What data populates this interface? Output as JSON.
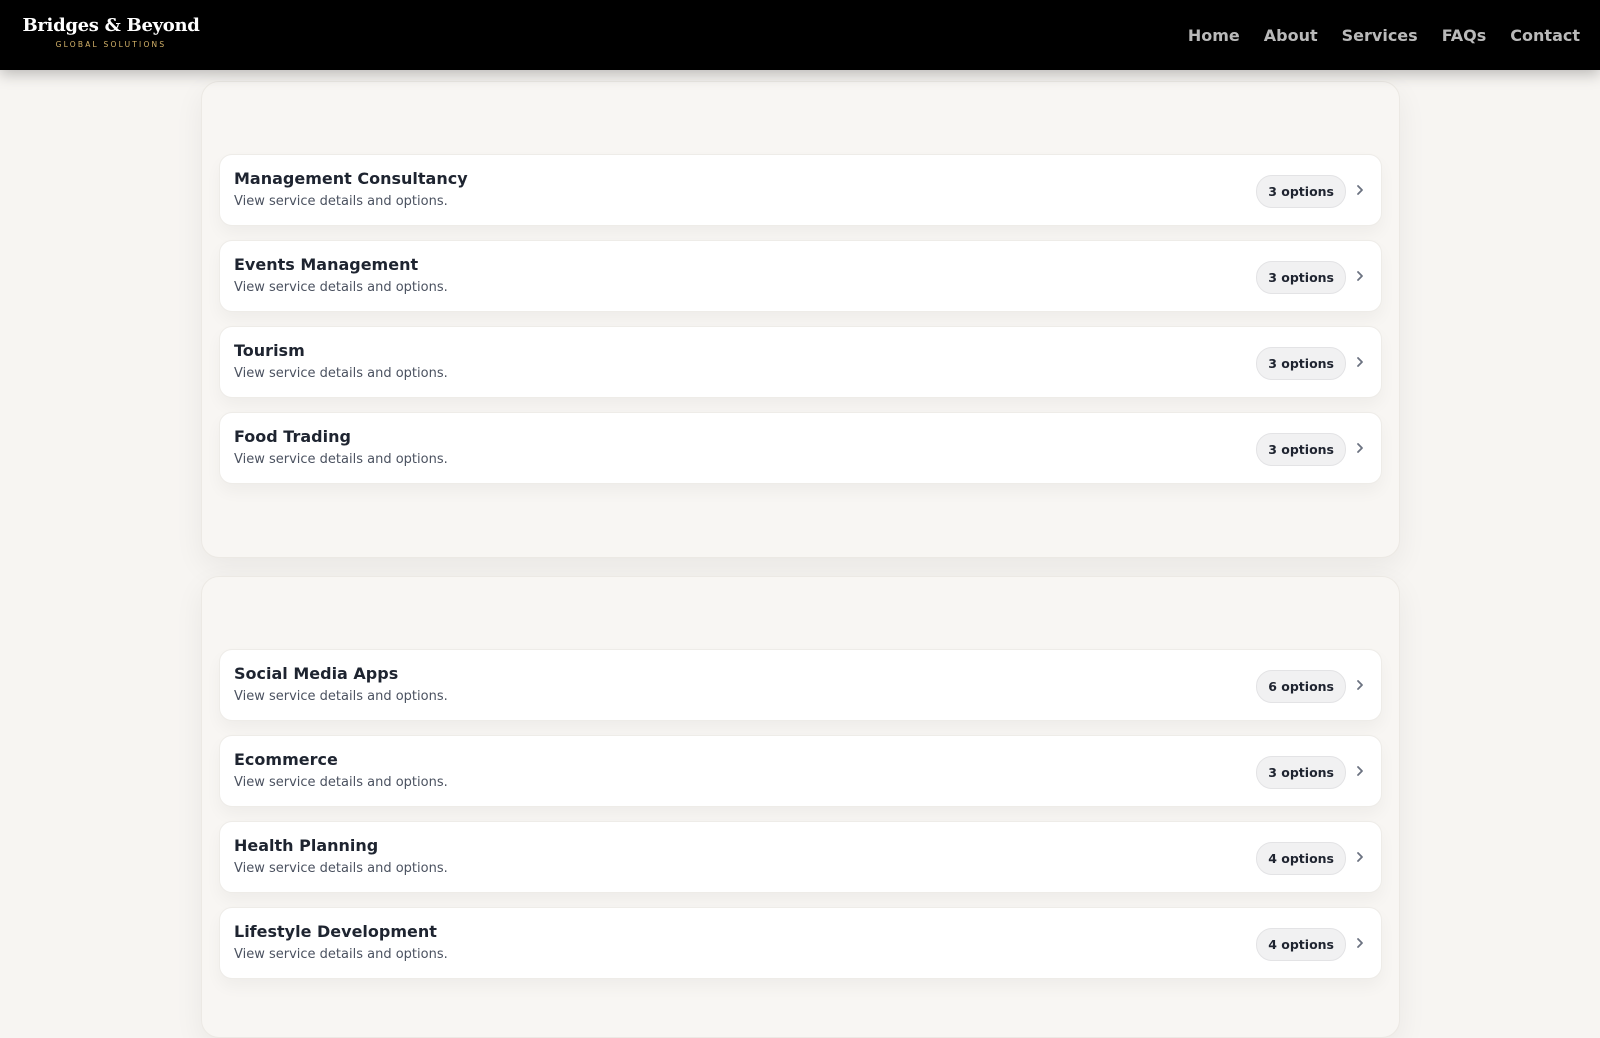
{
  "header": {
    "logo_main": "Bridges & Beyond",
    "logo_sub": "GLOBAL SOLUTIONS",
    "nav": [
      "Home",
      "About",
      "Services",
      "FAQs",
      "Contact"
    ]
  },
  "sections": [
    {
      "items": [
        {
          "title": "Management Consultancy",
          "description": "View service details and options.",
          "badge": "3 options",
          "icon": "chevron-right-icon"
        },
        {
          "title": "Events Management",
          "description": "View service details and options.",
          "badge": "3 options",
          "icon": "chevron-right-icon"
        },
        {
          "title": "Tourism",
          "description": "View service details and options.",
          "badge": "3 options",
          "icon": "chevron-right-icon"
        },
        {
          "title": "Food Trading",
          "description": "View service details and options.",
          "badge": "3 options",
          "icon": "chevron-right-icon"
        }
      ]
    },
    {
      "items": [
        {
          "title": "Social Media Apps",
          "description": "View service details and options.",
          "badge": "6 options",
          "icon": "chevron-right-icon"
        },
        {
          "title": "Ecommerce",
          "description": "View service details and options.",
          "badge": "3 options",
          "icon": "chevron-right-icon"
        },
        {
          "title": "Health Planning",
          "description": "View service details and options.",
          "badge": "4 options",
          "icon": "chevron-right-icon"
        },
        {
          "title": "Lifestyle Development",
          "description": "View service details and options.",
          "badge": "4 options",
          "icon": "chevron-right-icon"
        }
      ]
    }
  ],
  "colors": {
    "header_bg": "#000000",
    "logo_accent": "#d6b46a",
    "page_bg": "#f7f5f2",
    "nav_text": "#b9b9b9"
  }
}
